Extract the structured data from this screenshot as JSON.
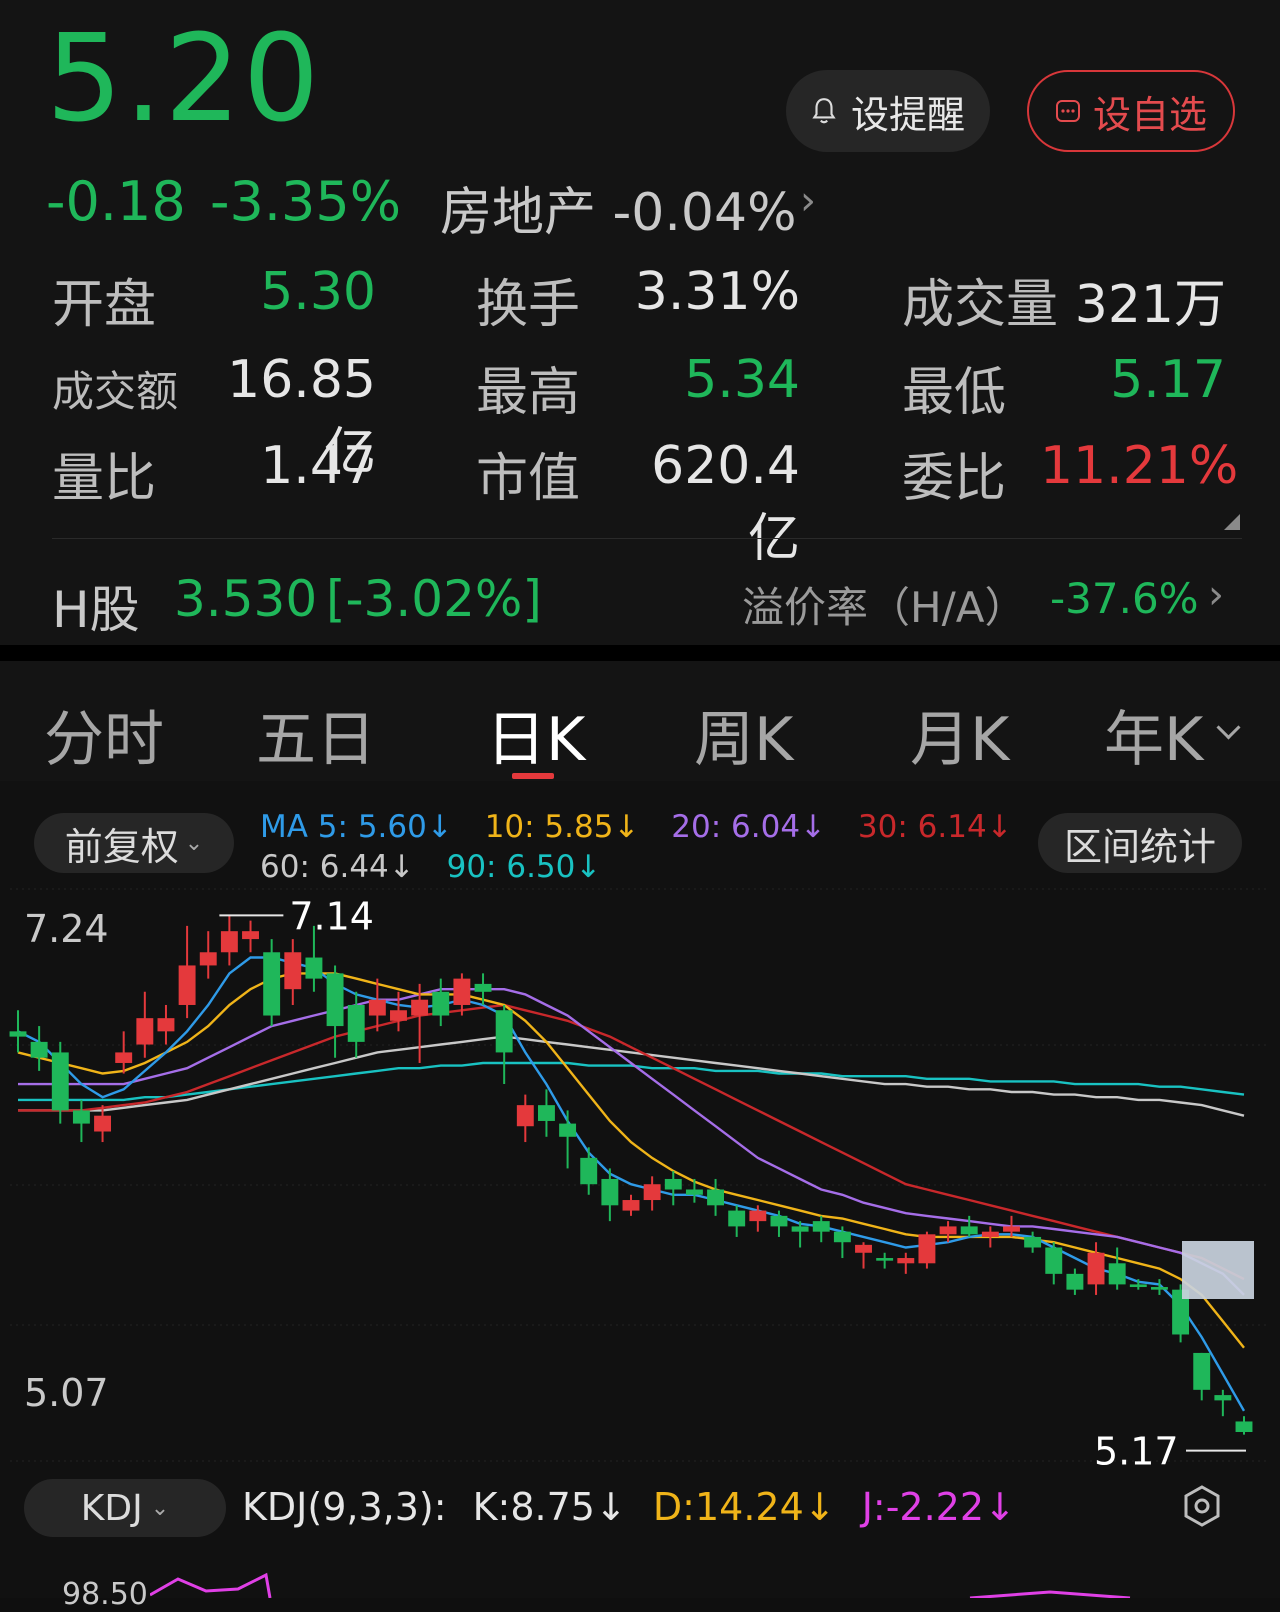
{
  "quote": {
    "price": "5.20",
    "change": "-0.18",
    "change_pct": "-3.35%",
    "sector_name": "房地产",
    "sector_change": "-0.04%"
  },
  "actions": {
    "remind_label": "设提醒",
    "watchlist_label": "设自选"
  },
  "stats": [
    {
      "label": "开盘",
      "value": "5.30"
    },
    {
      "label": "换手",
      "value": "3.31%"
    },
    {
      "label": "成交量",
      "value": "321万"
    },
    {
      "label": "成交额",
      "value": "16.85亿"
    },
    {
      "label": "最高",
      "value": "5.34"
    },
    {
      "label": "最低",
      "value": "5.17"
    },
    {
      "label": "量比",
      "value": "1.47"
    },
    {
      "label": "市值",
      "value": "620.4亿"
    },
    {
      "label": "委比",
      "value": "11.21%"
    }
  ],
  "h_share": {
    "label": "H股",
    "price": "3.530",
    "change": "[-3.02%]",
    "premium_label": "溢价率（H/A）",
    "premium_value": "-37.6%"
  },
  "tabs": [
    {
      "label": "分时"
    },
    {
      "label": "五日"
    },
    {
      "label": "日K",
      "active": true
    },
    {
      "label": "周K"
    },
    {
      "label": "月K"
    },
    {
      "label": "年K"
    }
  ],
  "chart_controls": {
    "adjust_label": "前复权",
    "range_label": "区间统计",
    "ma": [
      {
        "text": "MA 5: 5.60",
        "color": "#2f9be8"
      },
      {
        "text": "10: 5.85",
        "color": "#f0b419"
      },
      {
        "text": "20: 6.04",
        "color": "#a56ee8"
      },
      {
        "text": "30: 6.14",
        "color": "#c8282b"
      },
      {
        "text": "60: 6.44",
        "color": "#c8c8c8"
      },
      {
        "text": "90: 6.50",
        "color": "#19c2c2"
      }
    ],
    "arrow": "↓"
  },
  "axis": {
    "top_label": "7.24",
    "bottom_label": "5.07",
    "high_label": "7.14",
    "low_label": "5.17"
  },
  "kdj": {
    "selector_label": "KDJ",
    "title": "KDJ(9,3,3):",
    "k": "K:8.75",
    "d": "D:14.24",
    "j": "J:-2.22",
    "partial_axis_label": "98.50"
  },
  "chart_data": {
    "type": "candlestick",
    "ylim": [
      5.07,
      7.24
    ],
    "candles": [
      {
        "o": 6.7,
        "c": 6.68,
        "h": 6.78,
        "l": 6.62
      },
      {
        "o": 6.66,
        "c": 6.6,
        "h": 6.72,
        "l": 6.55
      },
      {
        "o": 6.62,
        "c": 6.4,
        "h": 6.66,
        "l": 6.35
      },
      {
        "o": 6.4,
        "c": 6.35,
        "h": 6.44,
        "l": 6.28
      },
      {
        "o": 6.32,
        "c": 6.38,
        "h": 6.42,
        "l": 6.28
      },
      {
        "o": 6.58,
        "c": 6.62,
        "h": 6.7,
        "l": 6.54
      },
      {
        "o": 6.65,
        "c": 6.75,
        "h": 6.85,
        "l": 6.6
      },
      {
        "o": 6.7,
        "c": 6.75,
        "h": 6.8,
        "l": 6.65
      },
      {
        "o": 6.8,
        "c": 6.95,
        "h": 7.1,
        "l": 6.75
      },
      {
        "o": 6.95,
        "c": 7.0,
        "h": 7.08,
        "l": 6.9
      },
      {
        "o": 7.0,
        "c": 7.08,
        "h": 7.14,
        "l": 6.95
      },
      {
        "o": 7.05,
        "c": 7.08,
        "h": 7.12,
        "l": 7.0
      },
      {
        "o": 7.0,
        "c": 6.76,
        "h": 7.05,
        "l": 6.72
      },
      {
        "o": 6.86,
        "c": 7.0,
        "h": 7.05,
        "l": 6.8
      },
      {
        "o": 6.98,
        "c": 6.9,
        "h": 7.1,
        "l": 6.85
      },
      {
        "o": 6.92,
        "c": 6.72,
        "h": 6.95,
        "l": 6.6
      },
      {
        "o": 6.8,
        "c": 6.66,
        "h": 6.85,
        "l": 6.6
      },
      {
        "o": 6.76,
        "c": 6.82,
        "h": 6.9,
        "l": 6.7
      },
      {
        "o": 6.74,
        "c": 6.78,
        "h": 6.85,
        "l": 6.7
      },
      {
        "o": 6.76,
        "c": 6.82,
        "h": 6.88,
        "l": 6.58
      },
      {
        "o": 6.85,
        "c": 6.76,
        "h": 6.9,
        "l": 6.72
      },
      {
        "o": 6.8,
        "c": 6.9,
        "h": 6.92,
        "l": 6.76
      },
      {
        "o": 6.88,
        "c": 6.85,
        "h": 6.92,
        "l": 6.8
      },
      {
        "o": 6.78,
        "c": 6.62,
        "h": 6.8,
        "l": 6.5
      },
      {
        "o": 6.34,
        "c": 6.42,
        "h": 6.46,
        "l": 6.28
      },
      {
        "o": 6.42,
        "c": 6.36,
        "h": 6.48,
        "l": 6.3
      },
      {
        "o": 6.35,
        "c": 6.3,
        "h": 6.4,
        "l": 6.18
      },
      {
        "o": 6.22,
        "c": 6.12,
        "h": 6.26,
        "l": 6.08
      },
      {
        "o": 6.14,
        "c": 6.04,
        "h": 6.18,
        "l": 5.98
      },
      {
        "o": 6.02,
        "c": 6.06,
        "h": 6.08,
        "l": 6.0
      },
      {
        "o": 6.06,
        "c": 6.12,
        "h": 6.15,
        "l": 6.02
      },
      {
        "o": 6.14,
        "c": 6.1,
        "h": 6.17,
        "l": 6.04
      },
      {
        "o": 6.1,
        "c": 6.08,
        "h": 6.14,
        "l": 6.05
      },
      {
        "o": 6.1,
        "c": 6.04,
        "h": 6.14,
        "l": 6.0
      },
      {
        "o": 6.02,
        "c": 5.96,
        "h": 6.04,
        "l": 5.92
      },
      {
        "o": 5.98,
        "c": 6.02,
        "h": 6.04,
        "l": 5.94
      },
      {
        "o": 6.0,
        "c": 5.96,
        "h": 6.02,
        "l": 5.92
      },
      {
        "o": 5.96,
        "c": 5.94,
        "h": 5.98,
        "l": 5.88
      },
      {
        "o": 5.98,
        "c": 5.94,
        "h": 6.0,
        "l": 5.9
      },
      {
        "o": 5.94,
        "c": 5.9,
        "h": 5.96,
        "l": 5.84
      },
      {
        "o": 5.86,
        "c": 5.89,
        "h": 5.9,
        "l": 5.8
      },
      {
        "o": 5.84,
        "c": 5.83,
        "h": 5.86,
        "l": 5.8
      },
      {
        "o": 5.82,
        "c": 5.84,
        "h": 5.86,
        "l": 5.78
      },
      {
        "o": 5.82,
        "c": 5.93,
        "h": 5.94,
        "l": 5.8
      },
      {
        "o": 5.93,
        "c": 5.96,
        "h": 5.98,
        "l": 5.9
      },
      {
        "o": 5.96,
        "c": 5.93,
        "h": 6.0,
        "l": 5.92
      },
      {
        "o": 5.92,
        "c": 5.94,
        "h": 5.96,
        "l": 5.88
      },
      {
        "o": 5.94,
        "c": 5.96,
        "h": 6.0,
        "l": 5.92
      },
      {
        "o": 5.92,
        "c": 5.88,
        "h": 5.94,
        "l": 5.86
      },
      {
        "o": 5.88,
        "c": 5.78,
        "h": 5.9,
        "l": 5.74
      },
      {
        "o": 5.78,
        "c": 5.72,
        "h": 5.8,
        "l": 5.7
      },
      {
        "o": 5.74,
        "c": 5.86,
        "h": 5.9,
        "l": 5.7
      },
      {
        "o": 5.82,
        "c": 5.74,
        "h": 5.88,
        "l": 5.72
      },
      {
        "o": 5.74,
        "c": 5.73,
        "h": 5.76,
        "l": 5.72
      },
      {
        "o": 5.73,
        "c": 5.72,
        "h": 5.76,
        "l": 5.7
      },
      {
        "o": 5.72,
        "c": 5.55,
        "h": 5.74,
        "l": 5.52
      },
      {
        "o": 5.48,
        "c": 5.34,
        "h": 5.48,
        "l": 5.3
      },
      {
        "o": 5.32,
        "c": 5.3,
        "h": 5.34,
        "l": 5.24
      },
      {
        "o": 5.22,
        "c": 5.18,
        "h": 5.24,
        "l": 5.17
      }
    ],
    "ma5": [
      6.7,
      6.66,
      6.58,
      6.5,
      6.45,
      6.48,
      6.55,
      6.62,
      6.7,
      6.8,
      6.92,
      6.98,
      6.98,
      6.96,
      6.94,
      6.88,
      6.84,
      6.82,
      6.8,
      6.79,
      6.8,
      6.82,
      6.8,
      6.76,
      6.62,
      6.5,
      6.36,
      6.24,
      6.16,
      6.12,
      6.1,
      6.08,
      6.08,
      6.06,
      6.04,
      6.02,
      6.0,
      5.97,
      5.96,
      5.94,
      5.92,
      5.9,
      5.88,
      5.89,
      5.9,
      5.92,
      5.93,
      5.93,
      5.92,
      5.88,
      5.84,
      5.8,
      5.78,
      5.75,
      5.74,
      5.66,
      5.54,
      5.4,
      5.26
    ],
    "ma10": [
      6.62,
      6.6,
      6.58,
      6.56,
      6.54,
      6.55,
      6.58,
      6.62,
      6.66,
      6.72,
      6.8,
      6.86,
      6.9,
      6.92,
      6.92,
      6.92,
      6.9,
      6.88,
      6.86,
      6.84,
      6.84,
      6.84,
      6.82,
      6.8,
      6.74,
      6.66,
      6.56,
      6.46,
      6.36,
      6.28,
      6.22,
      6.17,
      6.13,
      6.1,
      6.08,
      6.06,
      6.04,
      6.02,
      6.0,
      5.99,
      5.97,
      5.95,
      5.93,
      5.92,
      5.92,
      5.92,
      5.92,
      5.92,
      5.91,
      5.9,
      5.88,
      5.86,
      5.84,
      5.82,
      5.8,
      5.76,
      5.7,
      5.6,
      5.5
    ],
    "ma20": [
      6.5,
      6.5,
      6.5,
      6.5,
      6.5,
      6.5,
      6.52,
      6.54,
      6.56,
      6.6,
      6.64,
      6.68,
      6.72,
      6.74,
      6.76,
      6.78,
      6.8,
      6.82,
      6.82,
      6.84,
      6.86,
      6.86,
      6.86,
      6.86,
      6.84,
      6.8,
      6.76,
      6.7,
      6.64,
      6.58,
      6.52,
      6.46,
      6.4,
      6.34,
      6.28,
      6.22,
      6.18,
      6.14,
      6.1,
      6.08,
      6.05,
      6.03,
      6.01,
      6.0,
      5.99,
      5.98,
      5.97,
      5.96,
      5.96,
      5.95,
      5.94,
      5.93,
      5.92,
      5.9,
      5.88,
      5.86,
      5.82,
      5.78,
      5.7
    ],
    "ma30": [
      6.4,
      6.4,
      6.4,
      6.4,
      6.41,
      6.42,
      6.43,
      6.45,
      6.47,
      6.5,
      6.53,
      6.56,
      6.59,
      6.62,
      6.65,
      6.68,
      6.7,
      6.72,
      6.74,
      6.76,
      6.77,
      6.78,
      6.79,
      6.8,
      6.78,
      6.76,
      6.74,
      6.71,
      6.68,
      6.64,
      6.6,
      6.56,
      6.52,
      6.48,
      6.44,
      6.4,
      6.36,
      6.32,
      6.28,
      6.24,
      6.2,
      6.16,
      6.12,
      6.1,
      6.08,
      6.06,
      6.04,
      6.02,
      6.0,
      5.98,
      5.96,
      5.94,
      5.92,
      5.9,
      5.88,
      5.86,
      5.84,
      5.8,
      5.76
    ],
    "ma60": [
      6.4,
      6.4,
      6.4,
      6.4,
      6.4,
      6.41,
      6.42,
      6.43,
      6.44,
      6.46,
      6.48,
      6.5,
      6.52,
      6.54,
      6.56,
      6.58,
      6.6,
      6.62,
      6.63,
      6.64,
      6.65,
      6.66,
      6.67,
      6.68,
      6.67,
      6.66,
      6.65,
      6.64,
      6.63,
      6.62,
      6.61,
      6.6,
      6.59,
      6.58,
      6.57,
      6.56,
      6.55,
      6.54,
      6.53,
      6.52,
      6.51,
      6.5,
      6.5,
      6.49,
      6.49,
      6.48,
      6.48,
      6.47,
      6.47,
      6.46,
      6.46,
      6.45,
      6.45,
      6.44,
      6.44,
      6.43,
      6.42,
      6.4,
      6.38
    ],
    "ma90": [
      6.44,
      6.44,
      6.44,
      6.44,
      6.44,
      6.44,
      6.45,
      6.45,
      6.46,
      6.47,
      6.48,
      6.49,
      6.5,
      6.51,
      6.52,
      6.53,
      6.54,
      6.55,
      6.56,
      6.56,
      6.57,
      6.57,
      6.58,
      6.58,
      6.58,
      6.58,
      6.58,
      6.57,
      6.57,
      6.57,
      6.56,
      6.56,
      6.56,
      6.55,
      6.55,
      6.55,
      6.54,
      6.54,
      6.54,
      6.53,
      6.53,
      6.53,
      6.53,
      6.52,
      6.52,
      6.52,
      6.51,
      6.51,
      6.51,
      6.51,
      6.5,
      6.5,
      6.5,
      6.5,
      6.49,
      6.49,
      6.48,
      6.47,
      6.46
    ]
  }
}
